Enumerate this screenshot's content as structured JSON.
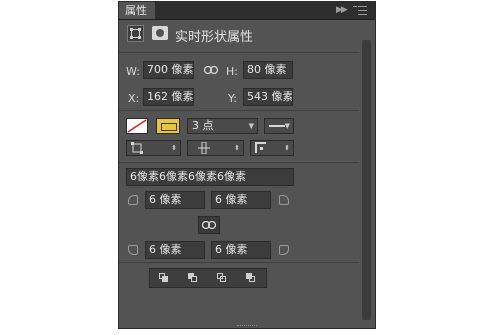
{
  "panel": {
    "tab_label": "属性",
    "section_title": "实时形状属性"
  },
  "transform": {
    "w_label": "W:",
    "w_value": "700 像素",
    "h_label": "H:",
    "h_value": "80 像素",
    "x_label": "X:",
    "x_value": "162 像素",
    "y_label": "Y:",
    "y_value": "543 像素"
  },
  "stroke": {
    "fill_swatch_color": "#ffffff",
    "stroke_swatch_color": "#e8c540",
    "width_value": "3 点"
  },
  "corners": {
    "all_radius_value": "6像素6像素6像素6像素",
    "top_left": "6 像素",
    "top_right": "6 像素",
    "bottom_left": "6 像素",
    "bottom_right": "6 像素"
  },
  "icons": {
    "collapse": "double-chevron-right-icon",
    "menu": "panel-menu-icon",
    "link": "link-icon"
  }
}
